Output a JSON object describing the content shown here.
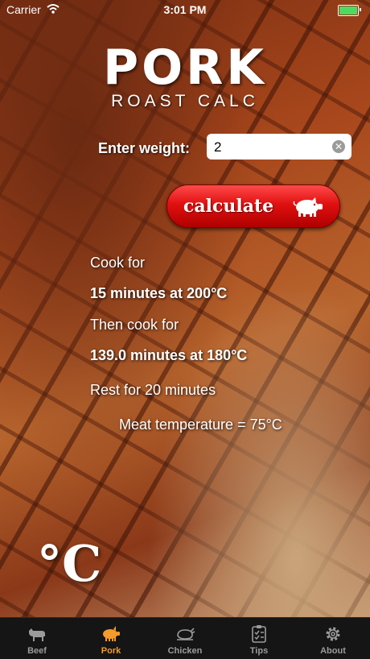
{
  "status_bar": {
    "carrier": "Carrier",
    "time": "3:01 PM"
  },
  "header": {
    "title": "PORK",
    "subtitle": "ROAST CALC"
  },
  "form": {
    "weight_label": "Enter weight:",
    "weight_value": "2",
    "calculate_label": "calculate"
  },
  "results": {
    "cook_for": "Cook for",
    "first_step": "15 minutes at 200°C",
    "then_cook_for": "Then cook for",
    "second_step": "139.0 minutes at 180°C",
    "rest": "Rest for 20 minutes",
    "meat_temp": "Meat temperature = 75°C"
  },
  "unit_toggle": {
    "label": "°C"
  },
  "tabs": [
    {
      "label": "Beef",
      "icon": "cow-icon",
      "active": false
    },
    {
      "label": "Pork",
      "icon": "pig-icon",
      "active": true
    },
    {
      "label": "Chicken",
      "icon": "chicken-icon",
      "active": false
    },
    {
      "label": "Tips",
      "icon": "checklist-icon",
      "active": false
    },
    {
      "label": "About",
      "icon": "gear-icon",
      "active": false
    }
  ],
  "colors": {
    "accent": "#f59b2c",
    "button_red": "#e01010",
    "tab_inactive": "#9b9b9b"
  }
}
